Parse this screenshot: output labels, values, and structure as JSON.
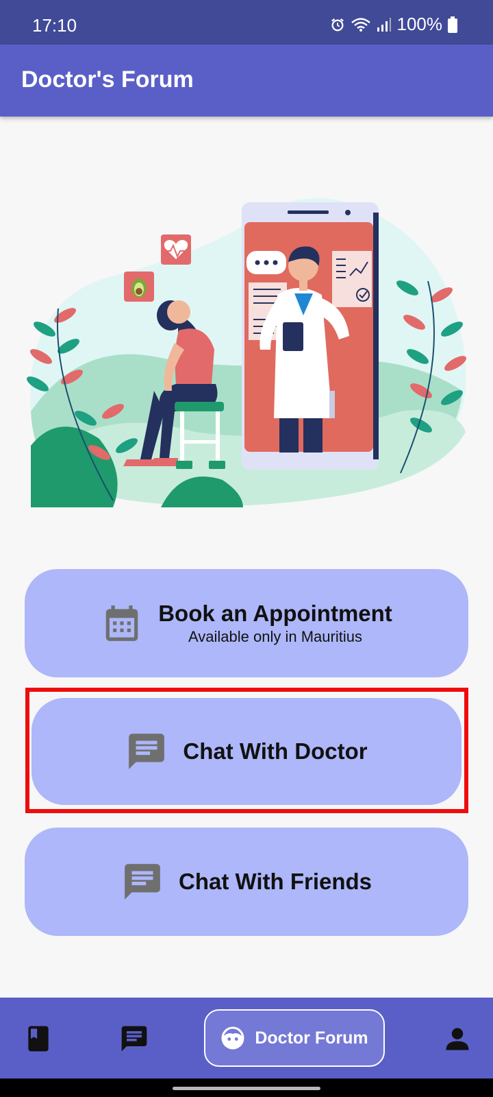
{
  "status": {
    "time": "17:10",
    "battery": "100%",
    "icons": [
      "alarm-icon",
      "wifi-icon",
      "signal-icon",
      "battery-icon"
    ]
  },
  "app_bar": {
    "title": "Doctor's Forum"
  },
  "hero": {
    "image": "doctor-illustration"
  },
  "actions": {
    "book": {
      "title": "Book an Appointment",
      "subtitle": "Available only in Mauritius",
      "icon": "calendar-icon"
    },
    "doctor": {
      "title": "Chat With Doctor",
      "icon": "chat-icon"
    },
    "friends": {
      "title": "Chat With Friends",
      "icon": "chat-icon"
    }
  },
  "bottom_nav": {
    "items": [
      {
        "icon": "book-icon"
      },
      {
        "icon": "message-icon"
      },
      {
        "icon": "face-icon",
        "label": "Doctor Forum"
      },
      {
        "icon": "person-icon"
      }
    ]
  },
  "colors": {
    "primary": "#5a5fc8",
    "status_bar": "#414a96",
    "button": "#adb7f9",
    "highlight": "#ee0d0d"
  }
}
